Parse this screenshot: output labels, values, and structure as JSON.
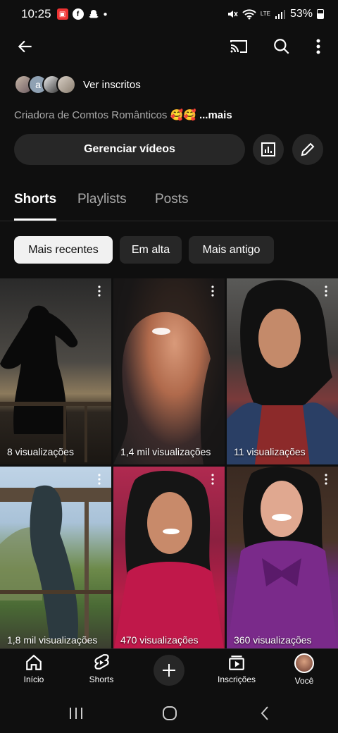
{
  "status_bar": {
    "time": "10:25",
    "battery": "53%",
    "network": "LTE"
  },
  "header": {
    "back_icon": "arrow-left-icon",
    "cast_icon": "cast-icon",
    "search_icon": "search-icon",
    "more_icon": "more-vert-icon"
  },
  "channel": {
    "subscribers_link": "Ver inscritos",
    "subscriber_avatar_letter": "a",
    "bio_prefix": "Criadora de",
    "bio_text": "Comtos Românticos 🥰🥰",
    "bio_more": "...mais",
    "manage_button": "Gerenciar vídeos"
  },
  "tabs": [
    {
      "label": "Shorts",
      "active": true
    },
    {
      "label": "Playlists",
      "active": false
    },
    {
      "label": "Posts",
      "active": false
    }
  ],
  "chips": [
    {
      "label": "Mais recentes",
      "active": true
    },
    {
      "label": "Em alta",
      "active": false
    },
    {
      "label": "Mais antigo",
      "active": false
    }
  ],
  "shorts": [
    {
      "views": "8 visualizações"
    },
    {
      "views": "1,4 mil visualizações"
    },
    {
      "views": "11 visualizações"
    },
    {
      "views": "1,8 mil visualizações"
    },
    {
      "views": "470 visualizações"
    },
    {
      "views": "360 visualizações"
    }
  ],
  "bottom_nav": [
    {
      "label": "Início",
      "icon": "home-icon"
    },
    {
      "label": "Shorts",
      "icon": "shorts-icon"
    },
    {
      "label": "",
      "icon": "plus-icon"
    },
    {
      "label": "Inscrições",
      "icon": "subscriptions-icon"
    },
    {
      "label": "Você",
      "icon": "avatar-icon"
    }
  ],
  "colors": {
    "background": "#0f0f0f",
    "surface": "#272727",
    "secondary_text": "#aaaaaa"
  }
}
